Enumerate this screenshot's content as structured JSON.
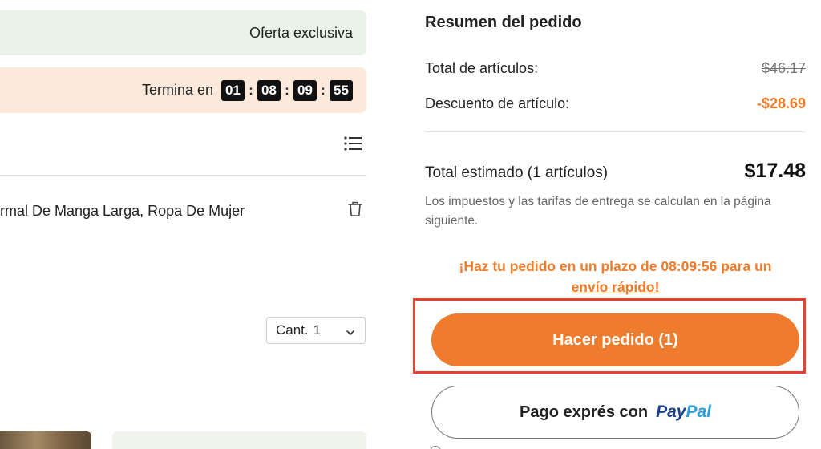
{
  "offer": {
    "label": "Oferta exclusiva"
  },
  "timer": {
    "label": "Termina en",
    "parts": [
      "01",
      "08",
      "09",
      "55"
    ],
    "separator": ":"
  },
  "cart_item": {
    "title": "rmal De Manga Larga, Ropa De Mujer",
    "quantity_label": "Cant.",
    "quantity_value": "1"
  },
  "summary": {
    "title": "Resumen del pedido",
    "total_items_label": "Total de artículos:",
    "total_items_value": "$46.17",
    "discount_label": "Descuento de artículo:",
    "discount_value": "-$28.69",
    "estimated_label": "Total estimado (1 artículos)",
    "estimated_value": "$17.48",
    "tax_note": "Los impuestos y las tarifas de entrega se calculan en la página siguiente.",
    "urgent_line1": "¡Haz tu pedido en un plazo de 08:09:56 para un",
    "urgent_line2": "envío rápido!"
  },
  "buttons": {
    "order": "Hacer pedido (1)",
    "paypal_prefix": "Pago exprés con",
    "paypal_brand_1": "Pay",
    "paypal_brand_2": "Pal"
  },
  "colors": {
    "accent_orange": "#ef7c2e",
    "highlight_red": "#e8422f",
    "offer_bg": "#e9f3e7",
    "timer_bg": "#fbeadb"
  },
  "icons": [
    "list-icon",
    "trash-icon",
    "chevron-down-icon"
  ]
}
